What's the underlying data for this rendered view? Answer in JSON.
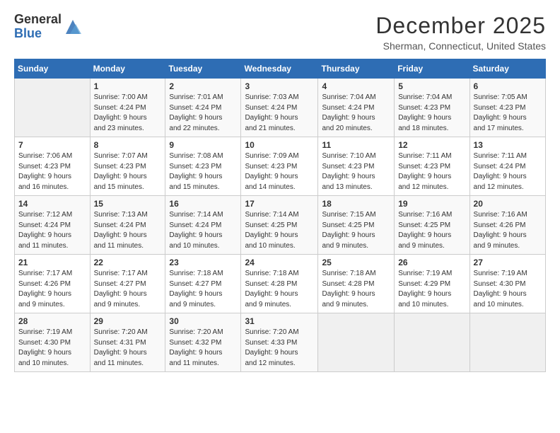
{
  "logo": {
    "general": "General",
    "blue": "Blue"
  },
  "title": "December 2025",
  "location": "Sherman, Connecticut, United States",
  "days_header": [
    "Sunday",
    "Monday",
    "Tuesday",
    "Wednesday",
    "Thursday",
    "Friday",
    "Saturday"
  ],
  "weeks": [
    [
      {
        "day": "",
        "content": ""
      },
      {
        "day": "1",
        "content": "Sunrise: 7:00 AM\nSunset: 4:24 PM\nDaylight: 9 hours\nand 23 minutes."
      },
      {
        "day": "2",
        "content": "Sunrise: 7:01 AM\nSunset: 4:24 PM\nDaylight: 9 hours\nand 22 minutes."
      },
      {
        "day": "3",
        "content": "Sunrise: 7:03 AM\nSunset: 4:24 PM\nDaylight: 9 hours\nand 21 minutes."
      },
      {
        "day": "4",
        "content": "Sunrise: 7:04 AM\nSunset: 4:24 PM\nDaylight: 9 hours\nand 20 minutes."
      },
      {
        "day": "5",
        "content": "Sunrise: 7:04 AM\nSunset: 4:23 PM\nDaylight: 9 hours\nand 18 minutes."
      },
      {
        "day": "6",
        "content": "Sunrise: 7:05 AM\nSunset: 4:23 PM\nDaylight: 9 hours\nand 17 minutes."
      }
    ],
    [
      {
        "day": "7",
        "content": "Sunrise: 7:06 AM\nSunset: 4:23 PM\nDaylight: 9 hours\nand 16 minutes."
      },
      {
        "day": "8",
        "content": "Sunrise: 7:07 AM\nSunset: 4:23 PM\nDaylight: 9 hours\nand 15 minutes."
      },
      {
        "day": "9",
        "content": "Sunrise: 7:08 AM\nSunset: 4:23 PM\nDaylight: 9 hours\nand 15 minutes."
      },
      {
        "day": "10",
        "content": "Sunrise: 7:09 AM\nSunset: 4:23 PM\nDaylight: 9 hours\nand 14 minutes."
      },
      {
        "day": "11",
        "content": "Sunrise: 7:10 AM\nSunset: 4:23 PM\nDaylight: 9 hours\nand 13 minutes."
      },
      {
        "day": "12",
        "content": "Sunrise: 7:11 AM\nSunset: 4:23 PM\nDaylight: 9 hours\nand 12 minutes."
      },
      {
        "day": "13",
        "content": "Sunrise: 7:11 AM\nSunset: 4:24 PM\nDaylight: 9 hours\nand 12 minutes."
      }
    ],
    [
      {
        "day": "14",
        "content": "Sunrise: 7:12 AM\nSunset: 4:24 PM\nDaylight: 9 hours\nand 11 minutes."
      },
      {
        "day": "15",
        "content": "Sunrise: 7:13 AM\nSunset: 4:24 PM\nDaylight: 9 hours\nand 11 minutes."
      },
      {
        "day": "16",
        "content": "Sunrise: 7:14 AM\nSunset: 4:24 PM\nDaylight: 9 hours\nand 10 minutes."
      },
      {
        "day": "17",
        "content": "Sunrise: 7:14 AM\nSunset: 4:25 PM\nDaylight: 9 hours\nand 10 minutes."
      },
      {
        "day": "18",
        "content": "Sunrise: 7:15 AM\nSunset: 4:25 PM\nDaylight: 9 hours\nand 9 minutes."
      },
      {
        "day": "19",
        "content": "Sunrise: 7:16 AM\nSunset: 4:25 PM\nDaylight: 9 hours\nand 9 minutes."
      },
      {
        "day": "20",
        "content": "Sunrise: 7:16 AM\nSunset: 4:26 PM\nDaylight: 9 hours\nand 9 minutes."
      }
    ],
    [
      {
        "day": "21",
        "content": "Sunrise: 7:17 AM\nSunset: 4:26 PM\nDaylight: 9 hours\nand 9 minutes."
      },
      {
        "day": "22",
        "content": "Sunrise: 7:17 AM\nSunset: 4:27 PM\nDaylight: 9 hours\nand 9 minutes."
      },
      {
        "day": "23",
        "content": "Sunrise: 7:18 AM\nSunset: 4:27 PM\nDaylight: 9 hours\nand 9 minutes."
      },
      {
        "day": "24",
        "content": "Sunrise: 7:18 AM\nSunset: 4:28 PM\nDaylight: 9 hours\nand 9 minutes."
      },
      {
        "day": "25",
        "content": "Sunrise: 7:18 AM\nSunset: 4:28 PM\nDaylight: 9 hours\nand 9 minutes."
      },
      {
        "day": "26",
        "content": "Sunrise: 7:19 AM\nSunset: 4:29 PM\nDaylight: 9 hours\nand 10 minutes."
      },
      {
        "day": "27",
        "content": "Sunrise: 7:19 AM\nSunset: 4:30 PM\nDaylight: 9 hours\nand 10 minutes."
      }
    ],
    [
      {
        "day": "28",
        "content": "Sunrise: 7:19 AM\nSunset: 4:30 PM\nDaylight: 9 hours\nand 10 minutes."
      },
      {
        "day": "29",
        "content": "Sunrise: 7:20 AM\nSunset: 4:31 PM\nDaylight: 9 hours\nand 11 minutes."
      },
      {
        "day": "30",
        "content": "Sunrise: 7:20 AM\nSunset: 4:32 PM\nDaylight: 9 hours\nand 11 minutes."
      },
      {
        "day": "31",
        "content": "Sunrise: 7:20 AM\nSunset: 4:33 PM\nDaylight: 9 hours\nand 12 minutes."
      },
      {
        "day": "",
        "content": ""
      },
      {
        "day": "",
        "content": ""
      },
      {
        "day": "",
        "content": ""
      }
    ]
  ]
}
